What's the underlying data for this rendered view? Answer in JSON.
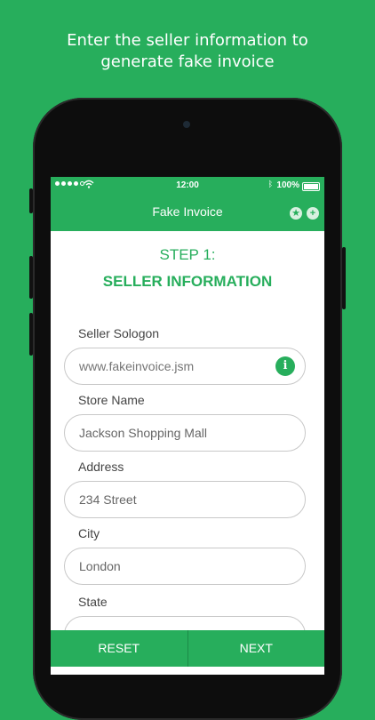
{
  "caption": {
    "line1": "Enter the seller information to",
    "line2": "generate fake invoice"
  },
  "status_bar": {
    "time": "12:00",
    "battery": "100%"
  },
  "nav": {
    "title": "Fake Invoice",
    "icons": [
      "star-icon",
      "plus-icon"
    ]
  },
  "step": {
    "number": "STEP 1:",
    "title": "SELLER INFORMATION"
  },
  "form": {
    "seller_slogan": {
      "label": "Seller Sologon",
      "placeholder": "www.fakeinvoice.jsm"
    },
    "store_name": {
      "label": "Store Name",
      "value": "Jackson Shopping Mall"
    },
    "address": {
      "label": "Address",
      "value": "234 Street"
    },
    "city": {
      "label": "City",
      "value": "London"
    },
    "state": {
      "label": "State",
      "value": ""
    }
  },
  "bottom": {
    "reset": "RESET",
    "next": "NEXT"
  },
  "colors": {
    "accent": "#27ae5c",
    "background": "#27ae5c"
  }
}
